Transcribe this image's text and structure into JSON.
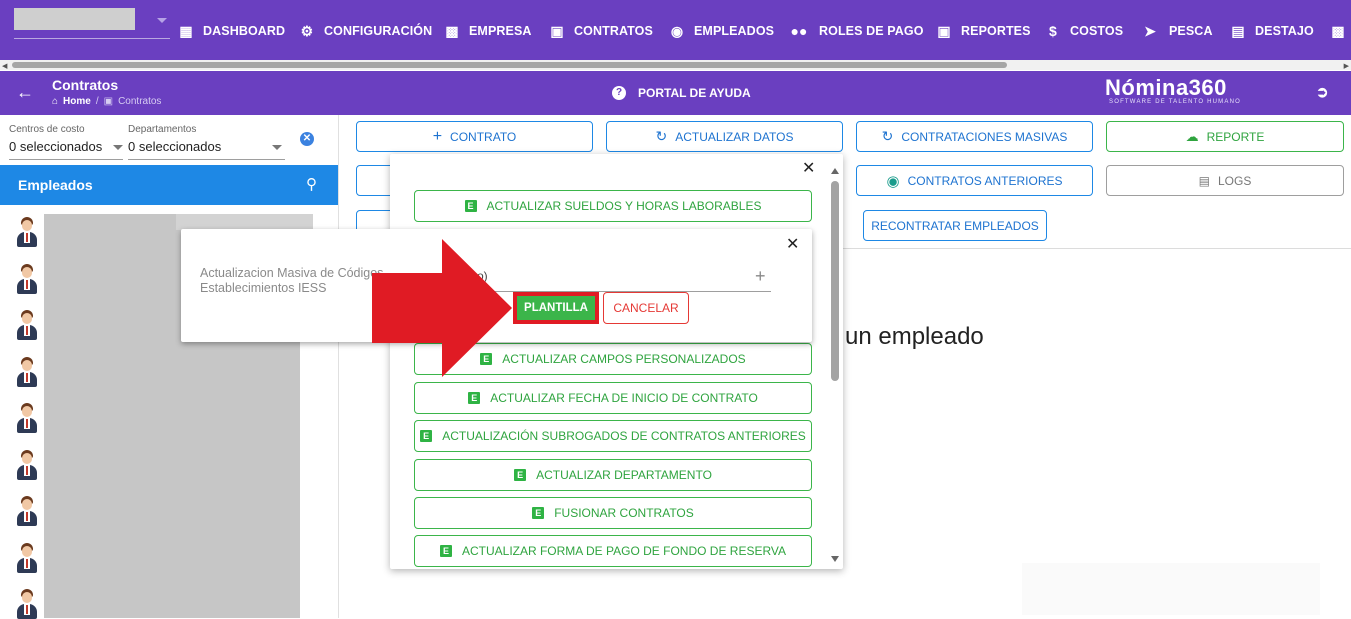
{
  "nav": {
    "items": [
      {
        "label": "DASHBOARD",
        "icon": "dashboard-icon"
      },
      {
        "label": "CONFIGURACIÓN",
        "icon": "gear-icon"
      },
      {
        "label": "EMPRESA",
        "icon": "building-icon"
      },
      {
        "label": "CONTRATOS",
        "icon": "clipboard-icon"
      },
      {
        "label": "EMPLEADOS",
        "icon": "globe-icon"
      },
      {
        "label": "ROLES DE PAGO",
        "icon": "users-icon"
      },
      {
        "label": "REPORTES",
        "icon": "clipboard-icon"
      },
      {
        "label": "COSTOS",
        "icon": "file-dollar-icon"
      },
      {
        "label": "PESCA",
        "icon": "fish-icon"
      },
      {
        "label": "DESTAJO",
        "icon": "document-icon"
      }
    ]
  },
  "subbar": {
    "title": "Contratos",
    "breadcrumb_home": "Home",
    "breadcrumb_current": "Contratos",
    "portal": "PORTAL DE AYUDA",
    "brand": "Nómina360",
    "brand_sub": "SOFTWARE DE TALENTO HUMANO"
  },
  "filters": {
    "cost_label": "Centros de costo",
    "cost_value": "0 seleccionados",
    "dept_label": "Departamentos",
    "dept_value": "0 seleccionados"
  },
  "employees": {
    "title": "Empleados",
    "avatar_count": 9
  },
  "actions": {
    "contrato": "CONTRATO",
    "actualizar": "ACTUALIZAR DATOS",
    "masivas": "CONTRATACIONES MASIVAS",
    "reporte": "REPORTE",
    "anteriores": "CONTRATOS ANTERIORES",
    "logs": "LOGS",
    "recontratar": "RECONTRATAR EMPLEADOS"
  },
  "hint": "un empleado",
  "bulk_menu": {
    "items": [
      "ACTUALIZAR SUELDOS Y HORAS LABORABLES",
      "ACTUALIZAR CAMPOS PERSONALIZADOS",
      "ACTUALIZAR FECHA DE INICIO DE CONTRATO",
      "ACTUALIZACIÓN SUBROGADOS DE CONTRATOS ANTERIORES",
      "ACTUALIZAR DEPARTAMENTO",
      "FUSIONAR CONTRATOS",
      "ACTUALIZAR FORMA DE PAGO DE FONDO DE RESERVA"
    ]
  },
  "modal": {
    "description": "Actualizacion Masiva de Códigos Establecimientos IESS",
    "file_fragment": "o)",
    "plantilla": "PLANTILLA",
    "cancelar": "CANCELAR"
  },
  "colors": {
    "brand": "#6a3fc0",
    "primary": "#1e88e5",
    "success": "#3bb54a",
    "danger": "#e53935",
    "annotation": "#e01b24"
  }
}
